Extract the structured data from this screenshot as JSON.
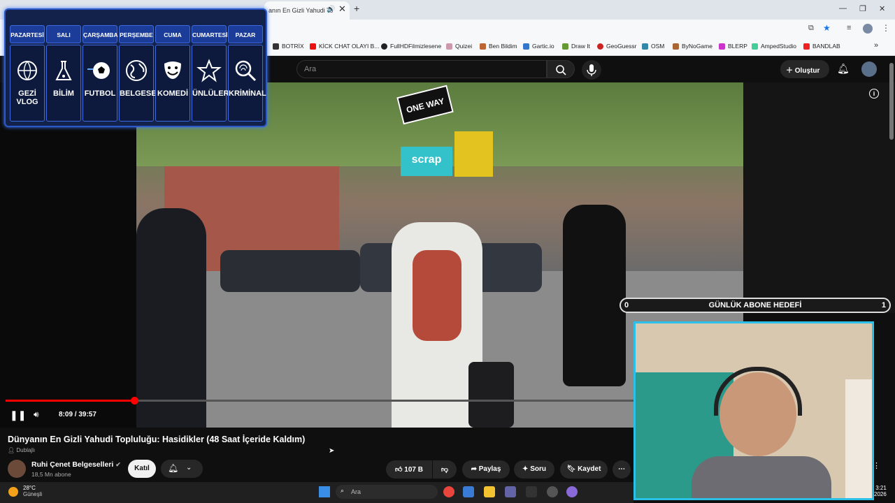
{
  "browser": {
    "tab_title": "anın En Gizli Yahudi To",
    "bookmarks": [
      "BOTRİX",
      "KİCK CHAT OLAYI B...",
      "FullHDFilmizlesene",
      "Quizei",
      "Ben Bildim",
      "Gartic.io",
      "Draw It",
      "GeoGuessr",
      "OSM",
      "ByNoGame",
      "BLERP",
      "AmpedStudio",
      "BANDLAB"
    ]
  },
  "youtube": {
    "search_placeholder": "Ara",
    "create_label": "Oluştur"
  },
  "schedule": {
    "days": [
      "PAZARTESİ",
      "SALI",
      "ÇARŞAMBA",
      "PERŞEMBE",
      "CUMA",
      "CUMARTESİ",
      "PAZAR"
    ],
    "categories": [
      "GEZİ VLOG",
      "BİLİM",
      "FUTBOL",
      "BELGESEL",
      "KOMEDİ",
      "ÜNLÜLER",
      "KRİMİNAL"
    ],
    "icons": [
      "globe-plane-icon",
      "science-flask-icon",
      "football-icon",
      "earth-icon",
      "theater-mask-icon",
      "star-icon",
      "fingerprint-magnifier-icon"
    ]
  },
  "player": {
    "time": "8:09 / 39:57",
    "progress": 0.204,
    "street_sign": "ONE WAY",
    "shop_sign": "scrap"
  },
  "goal": {
    "label": "GÜNLÜK ABONE HEDEFİ",
    "current": "0",
    "target": "1"
  },
  "video": {
    "title": "Dünyanın En Gizli Yahudi Topluluğu: Hasidikler (48 Saat İçeride Kaldım)",
    "dub_label": "Dublajlı",
    "channel": "Ruhi Çenet Belgeselleri",
    "subscribers": "18,5 Mn abone",
    "join_label": "Katıl",
    "likes": "107 B",
    "share_label": "Paylaş",
    "ask_label": "Soru",
    "save_label": "Kaydet"
  },
  "taskbar": {
    "temperature": "28°C",
    "weather": "Güneşli",
    "search_placeholder": "Ara",
    "time": "3:21",
    "year": "2026"
  }
}
